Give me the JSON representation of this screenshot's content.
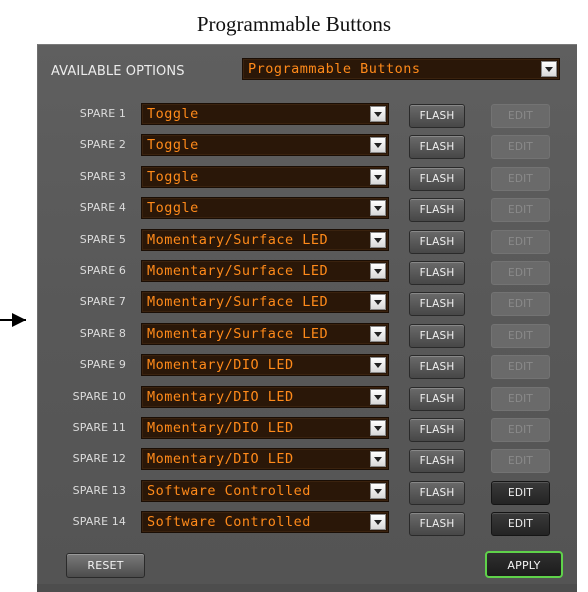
{
  "figure_title": "Programmable Buttons",
  "available_options": {
    "label": "AVAILABLE OPTIONS",
    "value": "Programmable Buttons"
  },
  "rows": [
    {
      "label": "SPARE 1",
      "mode": "Toggle",
      "flash": "FLASH",
      "edit": "EDIT",
      "edit_enabled": false
    },
    {
      "label": "SPARE 2",
      "mode": "Toggle",
      "flash": "FLASH",
      "edit": "EDIT",
      "edit_enabled": false
    },
    {
      "label": "SPARE 3",
      "mode": "Toggle",
      "flash": "FLASH",
      "edit": "EDIT",
      "edit_enabled": false
    },
    {
      "label": "SPARE 4",
      "mode": "Toggle",
      "flash": "FLASH",
      "edit": "EDIT",
      "edit_enabled": false
    },
    {
      "label": "SPARE 5",
      "mode": "Momentary/Surface LED",
      "flash": "FLASH",
      "edit": "EDIT",
      "edit_enabled": false
    },
    {
      "label": "SPARE 6",
      "mode": "Momentary/Surface LED",
      "flash": "FLASH",
      "edit": "EDIT",
      "edit_enabled": false
    },
    {
      "label": "SPARE 7",
      "mode": "Momentary/Surface LED",
      "flash": "FLASH",
      "edit": "EDIT",
      "edit_enabled": false
    },
    {
      "label": "SPARE 8",
      "mode": "Momentary/Surface LED",
      "flash": "FLASH",
      "edit": "EDIT",
      "edit_enabled": false
    },
    {
      "label": "SPARE 9",
      "mode": "Momentary/DIO LED",
      "flash": "FLASH",
      "edit": "EDIT",
      "edit_enabled": false
    },
    {
      "label": "SPARE 10",
      "mode": "Momentary/DIO LED",
      "flash": "FLASH",
      "edit": "EDIT",
      "edit_enabled": false
    },
    {
      "label": "SPARE 11",
      "mode": "Momentary/DIO LED",
      "flash": "FLASH",
      "edit": "EDIT",
      "edit_enabled": false
    },
    {
      "label": "SPARE 12",
      "mode": "Momentary/DIO LED",
      "flash": "FLASH",
      "edit": "EDIT",
      "edit_enabled": false
    },
    {
      "label": "SPARE 13",
      "mode": "Software Controlled",
      "flash": "FLASH",
      "edit": "EDIT",
      "edit_enabled": true
    },
    {
      "label": "SPARE 14",
      "mode": "Software Controlled",
      "flash": "FLASH",
      "edit": "EDIT",
      "edit_enabled": true
    }
  ],
  "footer": {
    "reset_label": "RESET",
    "apply_label": "APPLY"
  },
  "icons": {
    "pointer": "arrow-right-icon",
    "dropdown": "dropdown-arrow-icon"
  },
  "colors": {
    "panel_bg": "#585858",
    "combo_bg": "#2a1708",
    "combo_text": "#ff8a1a",
    "apply_border": "#5fd24a"
  }
}
